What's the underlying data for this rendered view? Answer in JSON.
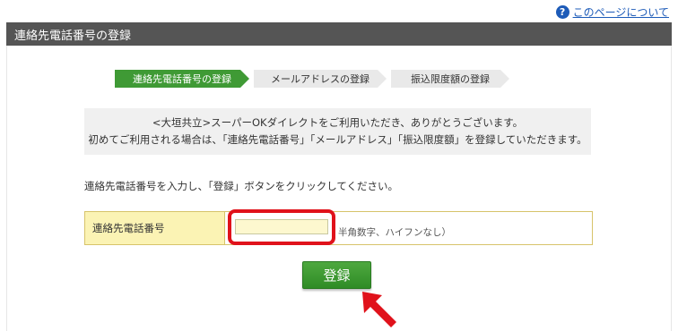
{
  "help": {
    "icon": "question-circle-icon",
    "icon_glyph": "?",
    "label": "このページについて"
  },
  "header": {
    "title": "連絡先電話番号の登録"
  },
  "steps": [
    {
      "label": "連絡先電話番号の登録",
      "active": true
    },
    {
      "label": "メールアドレスの登録",
      "active": false
    },
    {
      "label": "振込限度額の登録",
      "active": false
    }
  ],
  "intro": {
    "line1": "<大垣共立>スーパーOKダイレクトをご利用いただき、ありがとうございます。",
    "line2": "初めてご利用される場合は、「連絡先電話番号」「メールアドレス」「振込限度額」を登録していただきます。"
  },
  "instruction": "連絡先電話番号を入力し、「登録」ボタンをクリックしてください。",
  "form": {
    "label": "連絡先電話番号",
    "input_value": "",
    "hint": "半角数字、ハイフンなし）"
  },
  "button": {
    "label": "登録"
  },
  "colors": {
    "accent_green": "#3f9a35",
    "highlight_red": "#e0121b",
    "header_gray": "#555555"
  }
}
